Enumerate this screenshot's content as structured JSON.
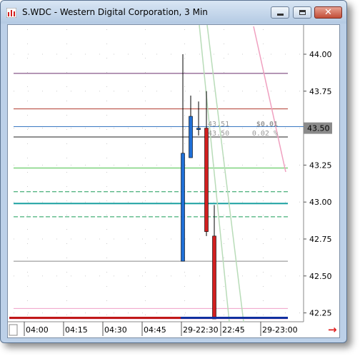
{
  "window": {
    "title": "S.WDC - Western Digital Corporation, 3 Min",
    "controls": {
      "close_glyph": "✕"
    }
  },
  "chart_data": {
    "type": "candlestick",
    "symbol": "S.WDC",
    "ylim": [
      42.15,
      44.15
    ],
    "y_ticks": [
      "44.00",
      "43.75",
      "43.50",
      "43.25",
      "43.00",
      "42.75",
      "42.50",
      "42.25"
    ],
    "x_ticks": [
      "04:00",
      "04:15",
      "04:30",
      "04:45",
      "29-22:30",
      "22:45",
      "29-23:00"
    ],
    "current_price_label": "43.50",
    "current_price": 43.5,
    "bid_ask": {
      "ask": "43.51",
      "bid": "43.50"
    },
    "change": {
      "amount": "$0.01",
      "percent": "0.02 %"
    },
    "candles": [
      {
        "open": 42.6,
        "high": 44.0,
        "low": 42.6,
        "close": 43.33,
        "color": "#1f6fd6"
      },
      {
        "open": 43.3,
        "high": 43.72,
        "low": 43.3,
        "close": 43.58,
        "color": "#1f6fd6"
      },
      {
        "open": 43.49,
        "high": 43.68,
        "low": 43.45,
        "close": 43.5,
        "color": "#1f6fd6"
      },
      {
        "open": 43.5,
        "high": 43.75,
        "low": 42.77,
        "close": 42.8,
        "color": "#d21f1f"
      },
      {
        "open": 42.77,
        "high": 42.98,
        "low": 42.18,
        "close": 42.18,
        "color": "#d21f1f"
      }
    ],
    "horizontal_lines": [
      {
        "value": 43.87,
        "color": "#6a2f6e",
        "dashed": false
      },
      {
        "value": 43.63,
        "color": "#b03a2e",
        "dashed": false
      },
      {
        "value": 43.51,
        "color": "#3a78c2",
        "dashed": false
      },
      {
        "value": 43.44,
        "color": "#222222",
        "dashed": false
      },
      {
        "value": 43.23,
        "color": "#4cc24c",
        "dashed": false
      },
      {
        "value": 43.07,
        "color": "#1a9c58",
        "dashed": true
      },
      {
        "value": 42.99,
        "color": "#1aa0a0",
        "dashed": false,
        "thick": true
      },
      {
        "value": 42.9,
        "color": "#1a9c58",
        "dashed": true
      },
      {
        "value": 42.6,
        "color": "#888888",
        "dashed": false
      },
      {
        "value": 42.28,
        "color": "#f0a0c8",
        "dashed": false
      },
      {
        "value": 42.21,
        "color": "#f0a0c8",
        "dashed": false
      }
    ],
    "trend_lines": [
      {
        "color": "#b8dcb8"
      },
      {
        "color": "#b8dcb8"
      },
      {
        "color": "#f0a0c0"
      }
    ]
  },
  "footer": {
    "scroll_arrow": "→"
  }
}
